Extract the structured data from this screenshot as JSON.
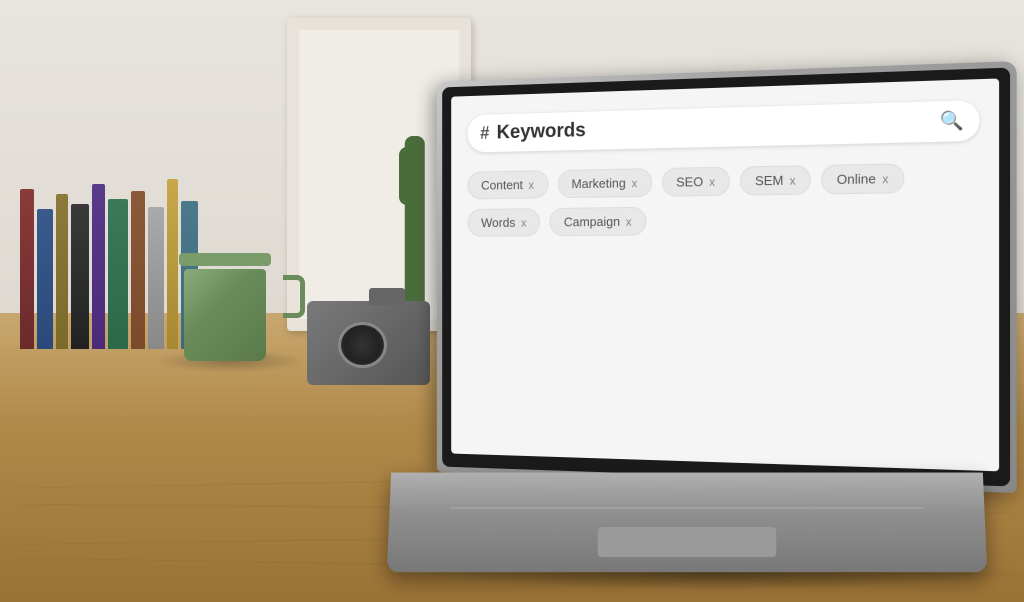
{
  "scene": {
    "title": "Keywords search interface on laptop",
    "background_wall_color": "#ddd8d0",
    "background_desk_color": "#c8a870"
  },
  "laptop_screen": {
    "search_bar": {
      "hash_symbol": "#",
      "placeholder": "Keywords",
      "search_icon": "🔍"
    },
    "tags": [
      {
        "label": "Content",
        "has_close": true
      },
      {
        "label": "Marketing",
        "has_close": true
      },
      {
        "label": "SEO",
        "has_close": true
      },
      {
        "label": "SEM",
        "has_close": true
      },
      {
        "label": "Online",
        "has_close": true
      },
      {
        "label": "Words",
        "has_close": true
      },
      {
        "label": "Campaign",
        "has_close": true
      }
    ],
    "tag_close_label": "x"
  }
}
